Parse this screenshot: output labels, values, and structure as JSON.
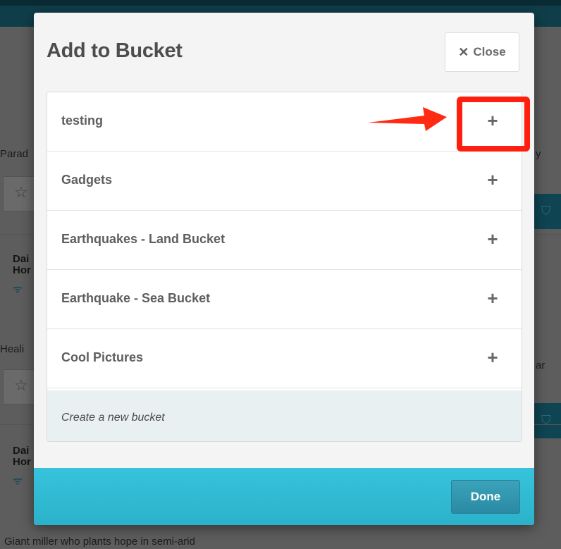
{
  "background": {
    "items": [
      {
        "snippet": "Parad"
      },
      {
        "snippet": "Heali"
      },
      {
        "snippet": "Giant miller who plants hope in semi-arid"
      }
    ],
    "source_labels": [
      "Dai",
      "Hor",
      "Dai",
      "Hor"
    ],
    "right_fragments": [
      "y",
      "ar"
    ],
    "rss_labels": [
      "\\",
      "\\"
    ]
  },
  "modal": {
    "title": "Add to Bucket",
    "close_label": "Close",
    "buckets": [
      {
        "label": "testing"
      },
      {
        "label": "Gadgets"
      },
      {
        "label": "Earthquakes - Land Bucket"
      },
      {
        "label": "Earthquake - Sea Bucket"
      },
      {
        "label": "Cool Pictures"
      }
    ],
    "create_label": "Create a new bucket",
    "done_label": "Done"
  },
  "icons": {
    "close": "x-icon",
    "add": "plus-icon",
    "star": "star-outline-icon",
    "rss": "rss-icon",
    "bucket": "add-to-bucket-icon"
  },
  "colors": {
    "annotation": "#ff1f0f",
    "footer": "#37c3dc",
    "done_button": "#2a8aa3"
  }
}
